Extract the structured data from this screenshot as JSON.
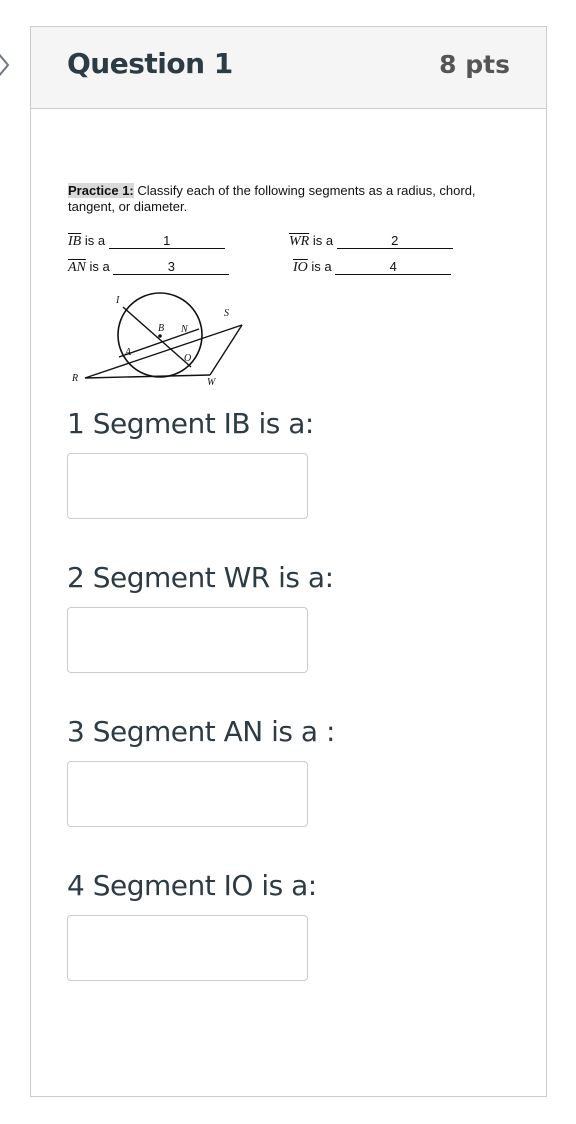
{
  "question": {
    "title": "Question 1",
    "points": "8 pts"
  },
  "practice": {
    "label": "Practice 1:",
    "instruction": " Classify each of the following segments as a radius, chord, tangent, or diameter.",
    "rows": [
      {
        "segment": "IB",
        "is_a": "is a",
        "blank": "1"
      },
      {
        "segment": "WR",
        "is_a": "is a",
        "blank": "2"
      },
      {
        "segment": "AN",
        "is_a": "is a",
        "blank": "3"
      },
      {
        "segment": "IO",
        "is_a": "is a",
        "blank": "4"
      }
    ]
  },
  "diagram": {
    "labels": [
      "I",
      "B",
      "N",
      "S",
      "A",
      "O",
      "R",
      "W"
    ]
  },
  "questions": [
    {
      "prompt": "1 Segment IB is a:",
      "value": ""
    },
    {
      "prompt": "2 Segment WR is a:",
      "value": ""
    },
    {
      "prompt": "3 Segment AN is a :",
      "value": ""
    },
    {
      "prompt": "4 Segment IO is a:",
      "value": ""
    }
  ]
}
